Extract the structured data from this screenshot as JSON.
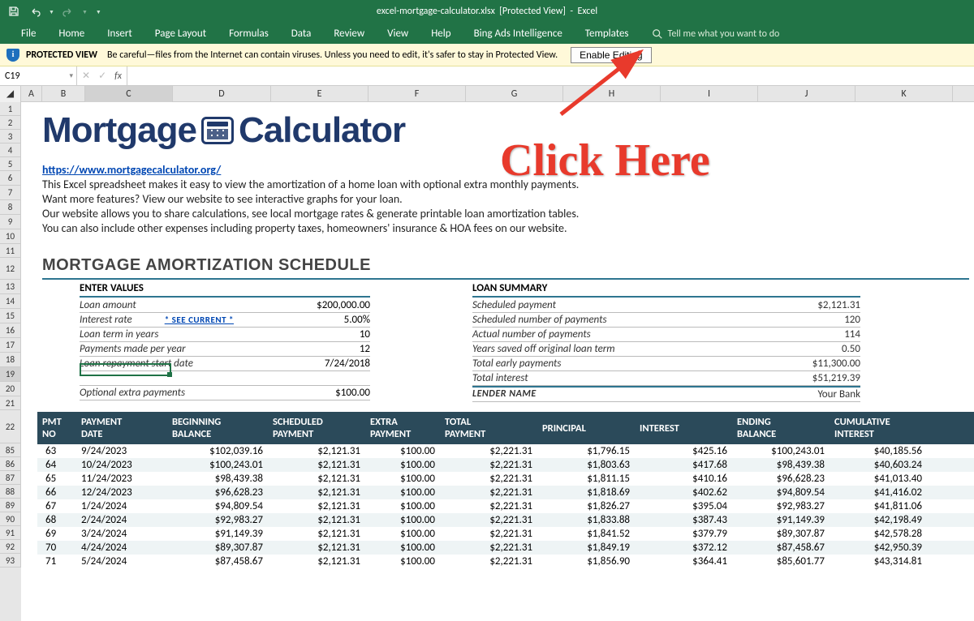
{
  "titlebar": {
    "filename": "excel-mortgage-calculator.xlsx",
    "mode": "[Protected View]",
    "app": "Excel"
  },
  "qat": {
    "save": "Save",
    "undo": "Undo",
    "redo": "Redo"
  },
  "ribbon": {
    "tabs": [
      "File",
      "Home",
      "Insert",
      "Page Layout",
      "Formulas",
      "Data",
      "Review",
      "View",
      "Help",
      "Bing Ads Intelligence",
      "Templates"
    ],
    "tellme": "Tell me what you want to do"
  },
  "protected_view": {
    "title": "PROTECTED VIEW",
    "message": "Be careful—files from the Internet can contain viruses. Unless you need to edit, it's safer to stay in Protected View.",
    "button": "Enable Editing"
  },
  "namebox": "C19",
  "formula": "",
  "columns": [
    "A",
    "B",
    "C",
    "D",
    "E",
    "F",
    "G",
    "H",
    "I",
    "J",
    "K"
  ],
  "row_headers_top": [
    "1",
    "2",
    "3",
    "4",
    "5",
    "6",
    "7",
    "8",
    "9",
    "10",
    "11",
    "12",
    "13",
    "14",
    "15",
    "16",
    "17",
    "18",
    "19",
    "20",
    "21",
    "22"
  ],
  "row_headers_data": [
    "85",
    "86",
    "87",
    "88",
    "89",
    "90",
    "91",
    "92",
    "93"
  ],
  "logo_part1": "Mortgage",
  "logo_part2": "Calculator",
  "annotation": "Click Here",
  "intro": {
    "url": "https://www.mortgagecalculator.org/",
    "lines": [
      "This Excel spreadsheet makes it easy to view the amortization of a home loan with optional extra monthly payments.",
      "Want more features? View our website to see interactive graphs for your loan.",
      "Our website allows you to share calculations, see local mortgage rates & generate printable loan amortization tables.",
      "You can also include other expenses including property taxes, homeowners' insurance & HOA fees on our website."
    ]
  },
  "section_title": "MORTGAGE AMORTIZATION SCHEDULE",
  "enter_values": {
    "header": "ENTER VALUES",
    "loan_amount_label": "Loan amount",
    "loan_amount": "$200,000.00",
    "interest_rate_label": "Interest rate",
    "see_current": "* SEE CURRENT *",
    "interest_rate": "5.00%",
    "loan_term_label": "Loan term in years",
    "loan_term": "10",
    "payments_per_year_label": "Payments made per year",
    "payments_per_year": "12",
    "start_date_label": "Loan repayment start date",
    "start_date": "7/24/2018",
    "extra_label": "Optional extra payments",
    "extra": "$100.00"
  },
  "loan_summary": {
    "header": "LOAN SUMMARY",
    "scheduled_payment_label": "Scheduled payment",
    "scheduled_payment": "$2,121.31",
    "scheduled_num_label": "Scheduled number of payments",
    "scheduled_num": "120",
    "actual_num_label": "Actual number of payments",
    "actual_num": "114",
    "years_saved_label": "Years saved off original loan term",
    "years_saved": "0.50",
    "early_payments_label": "Total early payments",
    "early_payments": "$11,300.00",
    "total_interest_label": "Total interest",
    "total_interest": "$51,219.39",
    "lender_label": "LENDER NAME",
    "lender": "Your Bank"
  },
  "amort": {
    "headers": [
      "PMT NO",
      "PAYMENT DATE",
      "BEGINNING BALANCE",
      "SCHEDULED PAYMENT",
      "EXTRA PAYMENT",
      "TOTAL PAYMENT",
      "PRINCIPAL",
      "INTEREST",
      "ENDING BALANCE",
      "CUMULATIVE INTEREST"
    ],
    "rows": [
      {
        "no": "63",
        "date": "9/24/2023",
        "beg": "$102,039.16",
        "sched": "$2,121.31",
        "extra": "$100.00",
        "total": "$2,221.31",
        "prin": "$1,796.15",
        "int": "$425.16",
        "end": "$100,243.01",
        "cum": "$40,185.56"
      },
      {
        "no": "64",
        "date": "10/24/2023",
        "beg": "$100,243.01",
        "sched": "$2,121.31",
        "extra": "$100.00",
        "total": "$2,221.31",
        "prin": "$1,803.63",
        "int": "$417.68",
        "end": "$98,439.38",
        "cum": "$40,603.24"
      },
      {
        "no": "65",
        "date": "11/24/2023",
        "beg": "$98,439.38",
        "sched": "$2,121.31",
        "extra": "$100.00",
        "total": "$2,221.31",
        "prin": "$1,811.15",
        "int": "$410.16",
        "end": "$96,628.23",
        "cum": "$41,013.40"
      },
      {
        "no": "66",
        "date": "12/24/2023",
        "beg": "$96,628.23",
        "sched": "$2,121.31",
        "extra": "$100.00",
        "total": "$2,221.31",
        "prin": "$1,818.69",
        "int": "$402.62",
        "end": "$94,809.54",
        "cum": "$41,416.02"
      },
      {
        "no": "67",
        "date": "1/24/2024",
        "beg": "$94,809.54",
        "sched": "$2,121.31",
        "extra": "$100.00",
        "total": "$2,221.31",
        "prin": "$1,826.27",
        "int": "$395.04",
        "end": "$92,983.27",
        "cum": "$41,811.06"
      },
      {
        "no": "68",
        "date": "2/24/2024",
        "beg": "$92,983.27",
        "sched": "$2,121.31",
        "extra": "$100.00",
        "total": "$2,221.31",
        "prin": "$1,833.88",
        "int": "$387.43",
        "end": "$91,149.39",
        "cum": "$42,198.49"
      },
      {
        "no": "69",
        "date": "3/24/2024",
        "beg": "$91,149.39",
        "sched": "$2,121.31",
        "extra": "$100.00",
        "total": "$2,221.31",
        "prin": "$1,841.52",
        "int": "$379.79",
        "end": "$89,307.87",
        "cum": "$42,578.28"
      },
      {
        "no": "70",
        "date": "4/24/2024",
        "beg": "$89,307.87",
        "sched": "$2,121.31",
        "extra": "$100.00",
        "total": "$2,221.31",
        "prin": "$1,849.19",
        "int": "$372.12",
        "end": "$87,458.67",
        "cum": "$42,950.39"
      },
      {
        "no": "71",
        "date": "5/24/2024",
        "beg": "$87,458.67",
        "sched": "$2,121.31",
        "extra": "$100.00",
        "total": "$2,221.31",
        "prin": "$1,856.90",
        "int": "$364.41",
        "end": "$85,601.77",
        "cum": "$43,314.81"
      }
    ]
  }
}
